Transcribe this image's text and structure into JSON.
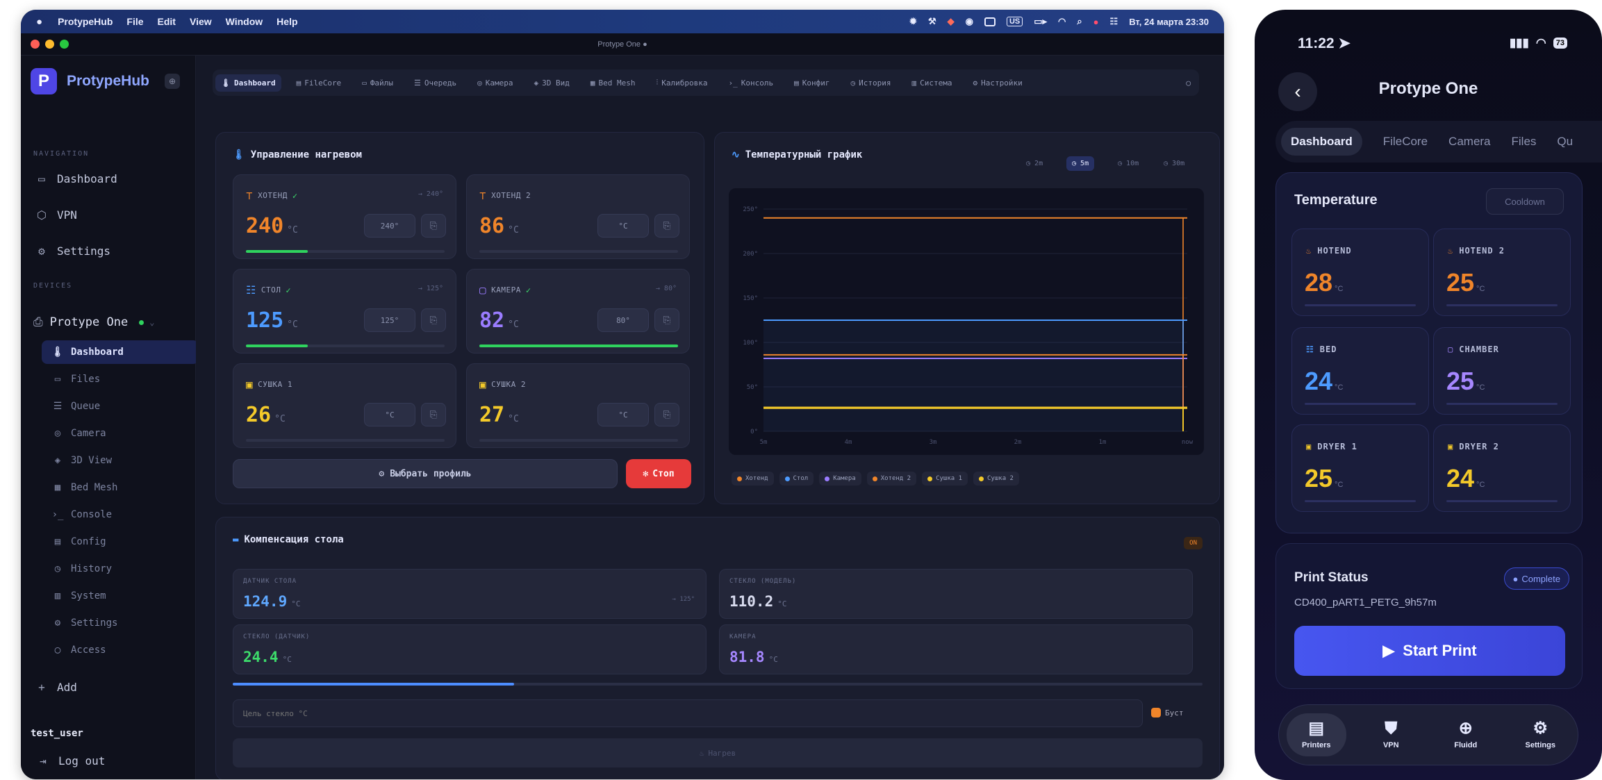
{
  "mac": {
    "menubar": {
      "app": "ProtypeHub",
      "items": [
        "File",
        "Edit",
        "View",
        "Window",
        "Help"
      ],
      "lang": "US",
      "clock": "Вт, 24 марта 23:30"
    },
    "window_title": "Protype One ●",
    "sidebar": {
      "brand": "ProtypeHub",
      "brand_badge": "⊕",
      "nav_heading": "NAVIGATION",
      "nav": [
        {
          "label": "Dashboard",
          "icon": "monitor-icon"
        },
        {
          "label": "VPN",
          "icon": "shield-icon"
        },
        {
          "label": "Settings",
          "icon": "gear-icon"
        }
      ],
      "devices_heading": "DEVICES",
      "device": "Protype One",
      "device_items": [
        "Dashboard",
        "Files",
        "Queue",
        "Camera",
        "3D View",
        "Bed Mesh",
        "Console",
        "Config",
        "History",
        "System",
        "Settings",
        "Access"
      ],
      "add": "Add",
      "user": "test_user",
      "logout": "Log out"
    },
    "tabs": [
      "Dashboard",
      "FileCore",
      "Файлы",
      "Очередь",
      "Камера",
      "3D Вид",
      "Bed Mesh",
      "Калибровка",
      "Консоль",
      "Конфиг",
      "История",
      "Система",
      "Настройки"
    ],
    "heat": {
      "title": "Управление нагревом",
      "cards": [
        {
          "name": "ХОТЕНД",
          "value": "240",
          "unit": "°C",
          "target": "→ 240°",
          "input": "240°",
          "ok": true,
          "color": "#f0852a",
          "progress": 0.31
        },
        {
          "name": "ХОТЕНД 2",
          "value": "86",
          "unit": "°C",
          "target": "",
          "input": "°C",
          "ok": false,
          "color": "#f0852a",
          "progress": 0
        },
        {
          "name": "СТОЛ",
          "value": "125",
          "unit": "°C",
          "target": "→ 125°",
          "input": "125°",
          "ok": true,
          "color": "#4d9bff",
          "progress": 0.31
        },
        {
          "name": "КАМЕРА",
          "value": "82",
          "unit": "°C",
          "target": "→ 80°",
          "input": "80°",
          "ok": true,
          "color": "#9a7cff",
          "progress": 1.0
        },
        {
          "name": "СУШКА 1",
          "value": "26",
          "unit": "°C",
          "target": "",
          "input": "°C",
          "ok": false,
          "color": "#f3c92a",
          "progress": 0
        },
        {
          "name": "СУШКА 2",
          "value": "27",
          "unit": "°C",
          "target": "",
          "input": "°C",
          "ok": false,
          "color": "#f3c92a",
          "progress": 0
        }
      ],
      "profile_btn": "Выбрать профиль",
      "stop_btn": "Стоп"
    },
    "graph": {
      "title": "Температурный график",
      "ranges": [
        "2m",
        "5m",
        "10m",
        "30m"
      ],
      "selected_range": "5m",
      "legend": [
        {
          "name": "Хотенд",
          "color": "#f0852a"
        },
        {
          "name": "Стол",
          "color": "#4d9bff"
        },
        {
          "name": "Камера",
          "color": "#9a7cff"
        },
        {
          "name": "Хотенд 2",
          "color": "#f0852a"
        },
        {
          "name": "Сушка 1",
          "color": "#f3c92a"
        },
        {
          "name": "Сушка 2",
          "color": "#f3c92a"
        }
      ]
    },
    "bed_comp": {
      "title": "Компенсация стола",
      "badge": "ON",
      "cells": [
        {
          "label": "ДАТЧИК СТОЛА",
          "value": "124.9",
          "unit": "°C",
          "target": "→ 125°",
          "color": "#5fa8ff"
        },
        {
          "label": "СТЕКЛО (МОДЕЛЬ)",
          "value": "110.2",
          "unit": "°C",
          "target": "",
          "color": "#d9dcef"
        },
        {
          "label": "СТЕКЛО (ДАТЧИК)",
          "value": "24.4",
          "unit": "°C",
          "target": "",
          "color": "#3ddc6b"
        },
        {
          "label": "КАМЕРА",
          "value": "81.8",
          "unit": "°C",
          "target": "",
          "color": "#a687ff"
        }
      ],
      "progress": 0.29,
      "target_placeholder": "Цель стекло °C",
      "boost": "Буст",
      "heat_btn": "Нагрев"
    }
  },
  "phone": {
    "time": "11:22",
    "battery": "73",
    "title": "Protype One",
    "tabs": [
      "Dashboard",
      "FileCore",
      "Camera",
      "Files",
      "Qu"
    ],
    "temp_title": "Temperature",
    "cooldown": "Cooldown",
    "cards": [
      {
        "name": "HOTEND",
        "value": "28",
        "unit": "°C",
        "color": "#f0852a"
      },
      {
        "name": "HOTEND 2",
        "value": "25",
        "unit": "°C",
        "color": "#f0852a"
      },
      {
        "name": "BED",
        "value": "24",
        "unit": "°C",
        "color": "#4d9bff"
      },
      {
        "name": "CHAMBER",
        "value": "25",
        "unit": "°C",
        "color": "#a687ff"
      },
      {
        "name": "DRYER 1",
        "value": "25",
        "unit": "°C",
        "color": "#f3c92a"
      },
      {
        "name": "DRYER 2",
        "value": "24",
        "unit": "°C",
        "color": "#f3c92a"
      }
    ],
    "print_status": "Print Status",
    "complete": "Complete",
    "filename": "CD400_pART1_PETG_9h57m",
    "start": "Start Print",
    "tabbar": [
      "Printers",
      "VPN",
      "Fluidd",
      "Settings"
    ]
  },
  "chart_data": {
    "type": "line",
    "title": "Температурный график",
    "xlabel": "",
    "ylabel": "",
    "x": [
      "5m",
      "4m",
      "3m",
      "2m",
      "1m",
      "now"
    ],
    "ylim": [
      0,
      250
    ],
    "yticks": [
      0,
      50,
      100,
      150,
      200,
      250
    ],
    "series": [
      {
        "name": "Хотенд",
        "color": "#f0852a",
        "values": [
          240,
          240,
          240,
          240,
          240,
          240
        ]
      },
      {
        "name": "Стол",
        "color": "#4d9bff",
        "values": [
          125,
          125,
          125,
          125,
          125,
          125
        ]
      },
      {
        "name": "Камера",
        "color": "#9a7cff",
        "values": [
          82,
          82,
          82,
          82,
          82,
          82
        ]
      },
      {
        "name": "Хотенд 2",
        "color": "#f0852a",
        "values": [
          86,
          86,
          86,
          86,
          86,
          86
        ]
      },
      {
        "name": "Сушка 1",
        "color": "#f3c92a",
        "values": [
          26,
          26,
          26,
          26,
          26,
          26
        ]
      },
      {
        "name": "Сушка 2",
        "color": "#f3c92a",
        "values": [
          27,
          27,
          27,
          27,
          27,
          27
        ]
      }
    ]
  }
}
